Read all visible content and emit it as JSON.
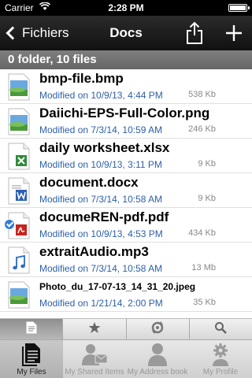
{
  "status_bar": {
    "carrier": "Carrier",
    "time": "2:28 PM",
    "battery_level": 1.0
  },
  "nav": {
    "back_label": "Fichiers",
    "title": "Docs",
    "share_icon": "share-icon",
    "add_icon": "plus-icon"
  },
  "section_header": "0 folder, 10 files",
  "files": [
    {
      "name": "bmp-file.bmp",
      "modified": "Modified on 10/9/13, 4:44 PM",
      "size": "538 Kb",
      "icon": "image-file-icon"
    },
    {
      "name": "Daiichi-EPS-Full-Color.png",
      "modified": "Modified on 7/3/14, 10:59 AM",
      "size": "246 Kb",
      "icon": "image-file-icon"
    },
    {
      "name": "daily worksheet.xlsx",
      "modified": "Modified on 10/9/13, 3:11 PM",
      "size": "9 Kb",
      "icon": "excel-file-icon"
    },
    {
      "name": "document.docx",
      "modified": "Modified on 7/3/14, 10:58 AM",
      "size": "9 Kb",
      "icon": "word-file-icon"
    },
    {
      "name": "documeREN-pdf.pdf",
      "modified": "Modified on 10/9/13, 4:53 PM",
      "size": "434 Kb",
      "icon": "pdf-file-icon"
    },
    {
      "name": "extraitAudio.mp3",
      "modified": "Modified on 7/3/14, 10:58 AM",
      "size": "13 Mb",
      "icon": "audio-file-icon"
    },
    {
      "name": "Photo_du_17-07-13_14_31_20.jpeg",
      "modified": "Modified on 1/21/14, 2:00 PM",
      "size": "35 Kb",
      "icon": "image-file-icon"
    }
  ],
  "sub_toolbar": [
    {
      "icon": "document-icon",
      "active": true
    },
    {
      "icon": "star-icon",
      "active": false
    },
    {
      "icon": "sync-icon",
      "active": false
    },
    {
      "icon": "search-icon",
      "active": false
    }
  ],
  "tabs": [
    {
      "label": "My Files",
      "active": true
    },
    {
      "label": "My Shared Items",
      "active": false
    },
    {
      "label": "My Address book",
      "active": false
    },
    {
      "label": "My Profile",
      "active": false
    }
  ],
  "colors": {
    "link_blue": "#2d5fa8",
    "excel_green": "#2e8b3a",
    "word_blue": "#2b5fb3",
    "pdf_red": "#c8231c",
    "check_blue": "#2f7fd9"
  }
}
